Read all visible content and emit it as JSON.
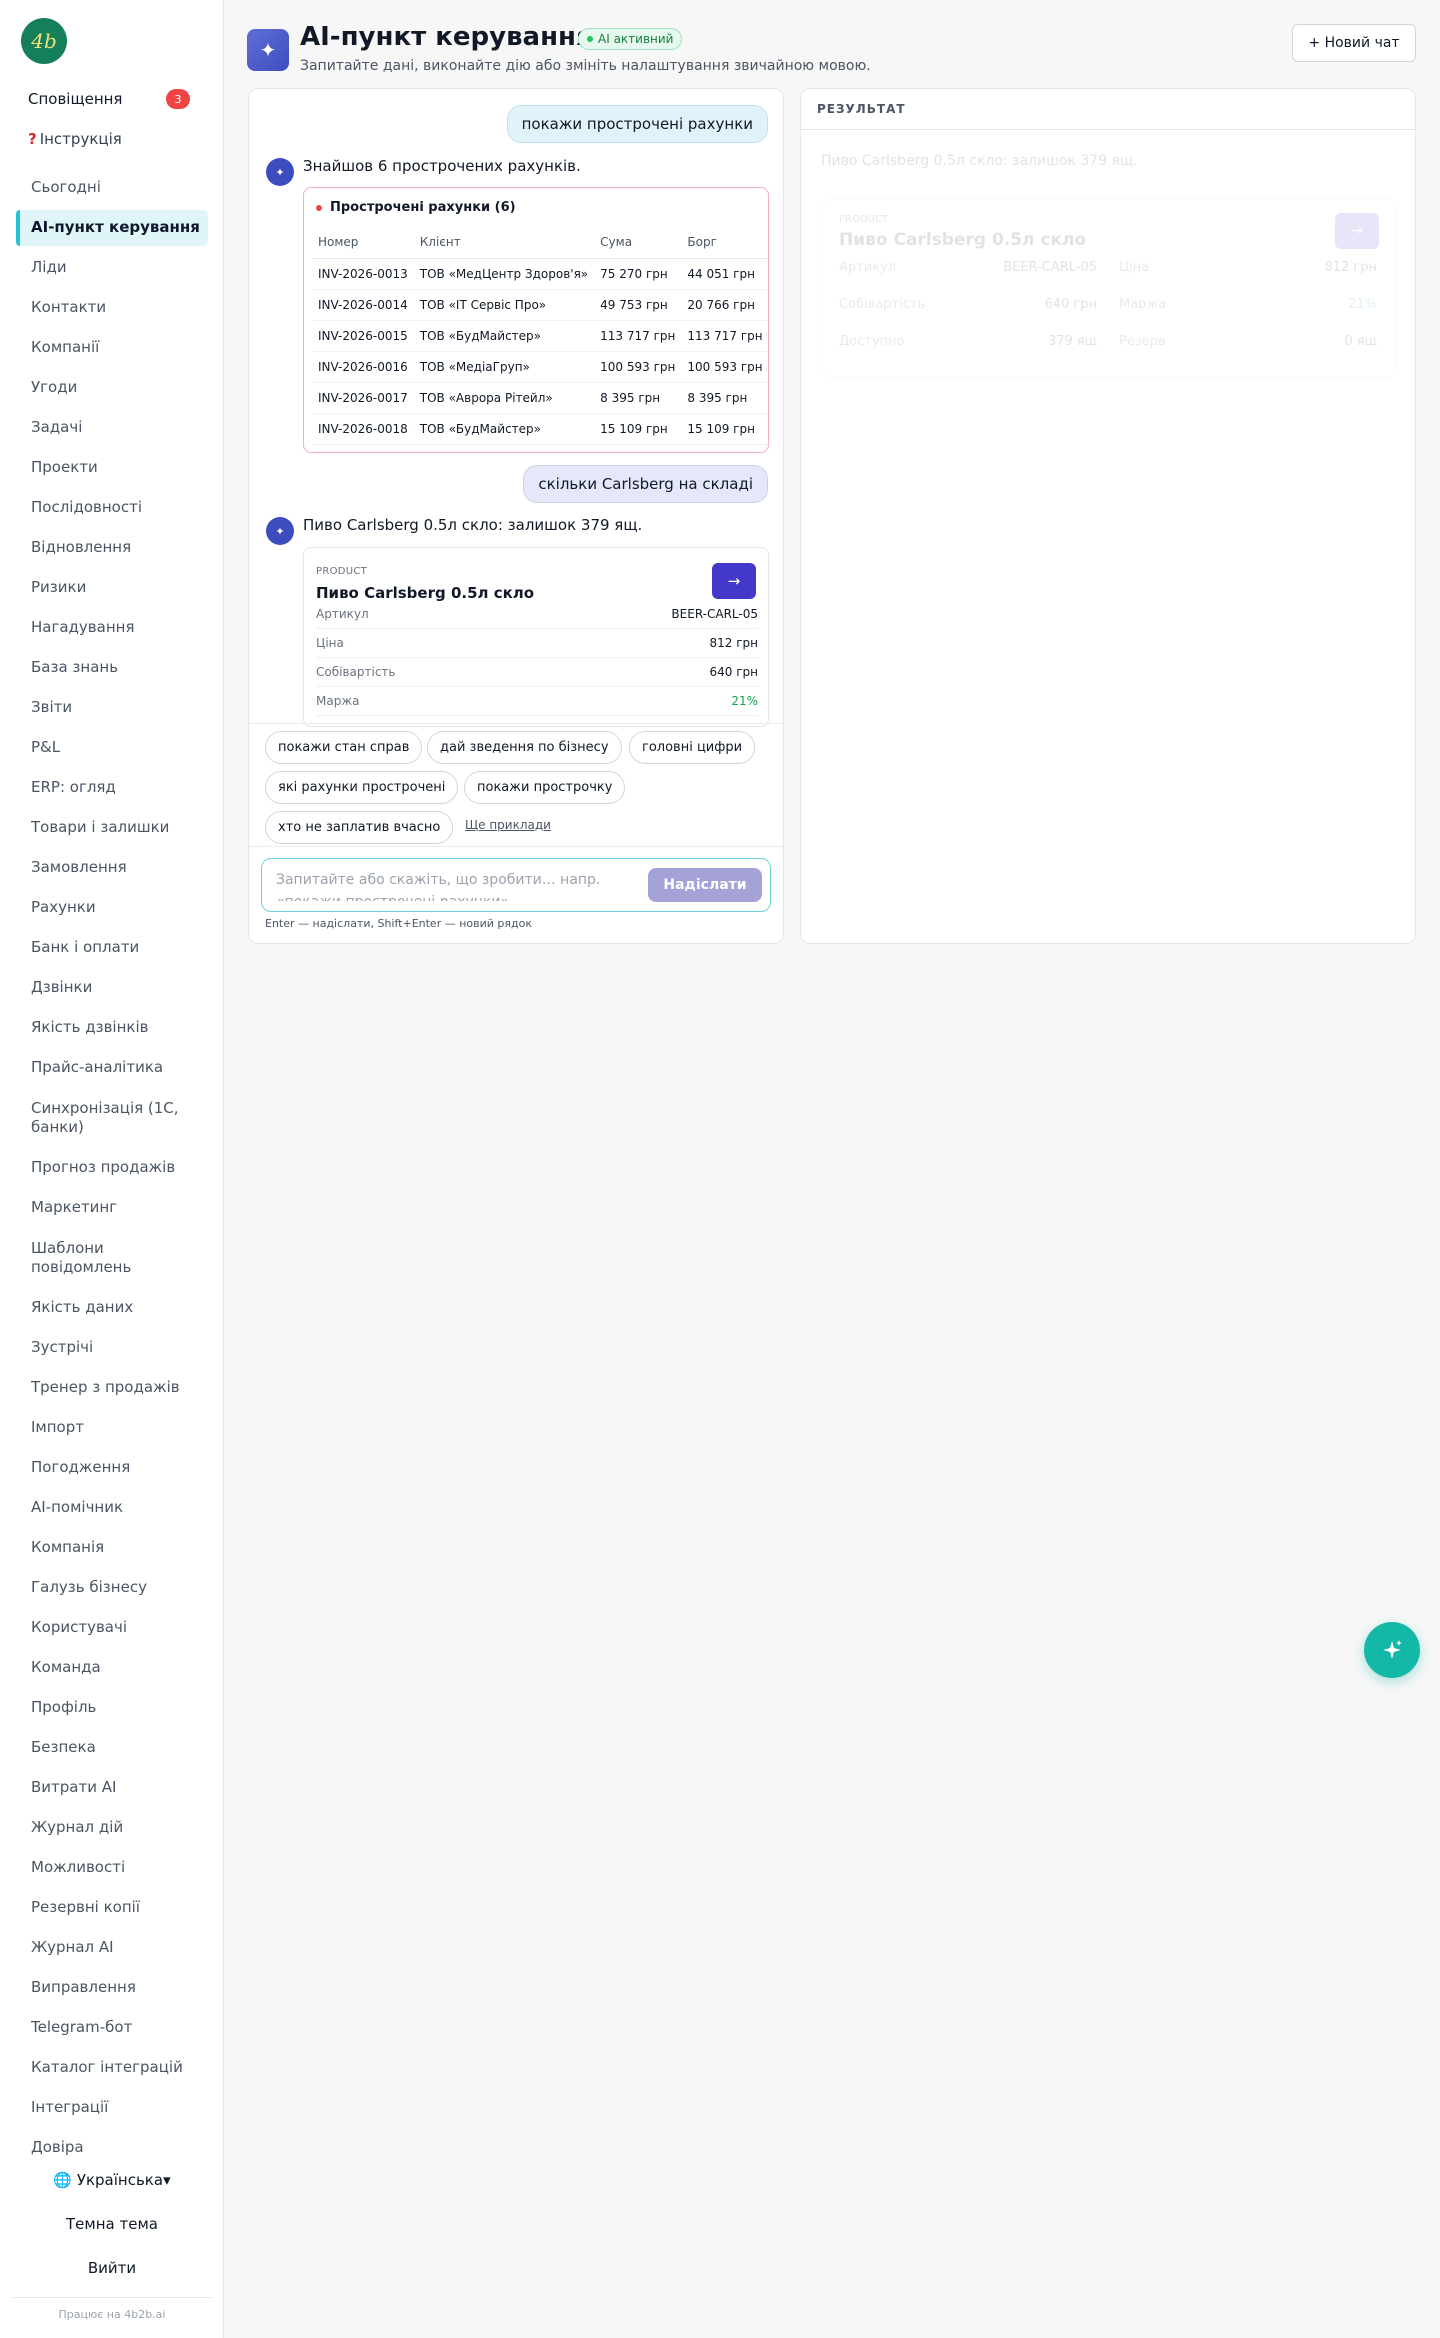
{
  "sidebar": {
    "logo_text": "4b",
    "notifications": {
      "label": "Сповіщення",
      "count": "3"
    },
    "guide": {
      "icon": "❓",
      "label": "Інструкція"
    },
    "items": [
      {
        "label": "Сьогодні"
      },
      {
        "label": "AI-пункт керування",
        "active": true
      },
      {
        "label": "Ліди"
      },
      {
        "label": "Контакти"
      },
      {
        "label": "Компанії"
      },
      {
        "label": "Угоди"
      },
      {
        "label": "Задачі"
      },
      {
        "label": "Проекти"
      },
      {
        "label": "Послідовності"
      },
      {
        "label": "Відновлення"
      },
      {
        "label": "Ризики"
      },
      {
        "label": "Нагадування"
      },
      {
        "label": "База знань"
      },
      {
        "label": "Звіти"
      },
      {
        "label": "P&L"
      },
      {
        "label": "ERP: огляд"
      },
      {
        "label": "Товари і залишки"
      },
      {
        "label": "Замовлення"
      },
      {
        "label": "Рахунки"
      },
      {
        "label": "Банк і оплати"
      },
      {
        "label": "Дзвінки"
      },
      {
        "label": "Якість дзвінків"
      },
      {
        "label": "Прайс-аналітика"
      },
      {
        "label": "Синхронізація (1С, банки)",
        "two_line": true
      },
      {
        "label": "Прогноз продажів"
      },
      {
        "label": "Маркетинг"
      },
      {
        "label": "Шаблони повідомлень",
        "two_line": true
      },
      {
        "label": "Якість даних"
      },
      {
        "label": "Зустрічі"
      },
      {
        "label": "Тренер з продажів"
      },
      {
        "label": "Імпорт"
      },
      {
        "label": "Погодження"
      },
      {
        "label": "AI-помічник"
      },
      {
        "label": "Компанія"
      },
      {
        "label": "Галузь бізнесу"
      },
      {
        "label": "Користувачі"
      },
      {
        "label": "Команда"
      },
      {
        "label": "Профіль"
      },
      {
        "label": "Безпека"
      },
      {
        "label": "Витрати AI"
      },
      {
        "label": "Журнал дій"
      },
      {
        "label": "Можливості"
      },
      {
        "label": "Резервні копії"
      },
      {
        "label": "Журнал AI"
      },
      {
        "label": "Виправлення"
      },
      {
        "label": "Telegram-бот"
      },
      {
        "label": "Каталог інтеграцій"
      },
      {
        "label": "Інтеграції"
      },
      {
        "label": "Довіра"
      }
    ],
    "language": "🌐 Українська▾",
    "theme": "Темна тема",
    "logout": "Вийти",
    "powered": "Працює на 4b2b.ai"
  },
  "header": {
    "icon": "✦",
    "title": "AI-пункт керування",
    "badge": "AI активний",
    "subtitle": "Запитайте дані, виконайте дію або змініть налаштування звичайною мовою.",
    "new_chat": "+ Новий чат"
  },
  "chat": {
    "user_message_1": "покажи прострочені рахунки",
    "ai_avatar": "✦",
    "ai_reply_1": "Знайшов 6 прострочених рахунків.",
    "invoices": {
      "title": "Прострочені рахунки (6)",
      "columns": [
        "Номер",
        "Клієнт",
        "Сума",
        "Борг"
      ],
      "rows": [
        [
          "INV-2026-0013",
          "ТОВ «МедЦентр Здоров'я»",
          "75 270 грн",
          "44 051 грн"
        ],
        [
          "INV-2026-0014",
          "ТОВ «IT Сервіс Про»",
          "49 753 грн",
          "20 766 грн"
        ],
        [
          "INV-2026-0015",
          "ТОВ «БудМайстер»",
          "113 717 грн",
          "113 717 грн"
        ],
        [
          "INV-2026-0016",
          "ТОВ «МедіаГруп»",
          "100 593 грн",
          "100 593 грн"
        ],
        [
          "INV-2026-0017",
          "ТОВ «Аврора Рітейл»",
          "8 395 грн",
          "8 395 грн"
        ],
        [
          "INV-2026-0018",
          "ТОВ «БудМайстер»",
          "15 109 грн",
          "15 109 грн"
        ]
      ]
    },
    "user_message_2": "скільки Carlsberg на складі",
    "ai_reply_2": "Пиво Carlsberg 0.5л скло: залишок 379 ящ.",
    "product": {
      "label": "PRODUCT",
      "name": "Пиво Carlsberg 0.5л скло",
      "go": "→",
      "rows": [
        {
          "key": "Артикул",
          "value": "BEER-CARL-05"
        },
        {
          "key": "Ціна",
          "value": "812 грн"
        },
        {
          "key": "Собівартість",
          "value": "640 грн"
        },
        {
          "key": "Маржа",
          "value": "21%"
        }
      ]
    },
    "suggestions": [
      "покажи стан справ",
      "дай зведення по бізнесу",
      "головні цифри",
      "які рахунки прострочені",
      "покажи прострочку",
      "хто не заплатив вчасно"
    ],
    "more_examples": "Ще приклади",
    "input_placeholder": "Запитайте або скажіть, що зробити… напр. «покажи прострочені рахунки»",
    "send": "Надіслати",
    "hint": "Enter — надіслати, Shift+Enter — новий рядок"
  },
  "result": {
    "title": "РЕЗУЛЬТАТ",
    "summary": "Пиво Carlsberg 0.5л скло: залишок 379 ящ.",
    "card": {
      "label": "PRODUCT",
      "name": "Пиво Carlsberg 0.5л скло",
      "go": "→",
      "fields": [
        {
          "key": "Артикул",
          "value": "BEER-CARL-05"
        },
        {
          "key": "Ціна",
          "value": "812 грн"
        },
        {
          "key": "Собівартість",
          "value": "640 грн"
        },
        {
          "key": "Маржа",
          "value": "21%"
        },
        {
          "key": "Доступно",
          "value": "379 ящ"
        },
        {
          "key": "Резерв",
          "value": "0 ящ"
        }
      ]
    }
  },
  "fab_icon": "sparkle-icon",
  "colors": {
    "accent": "#22c3d6",
    "primary": "#4338ca",
    "danger": "#ef4444",
    "success": "#16a34a",
    "fab": "#14b8a6"
  }
}
